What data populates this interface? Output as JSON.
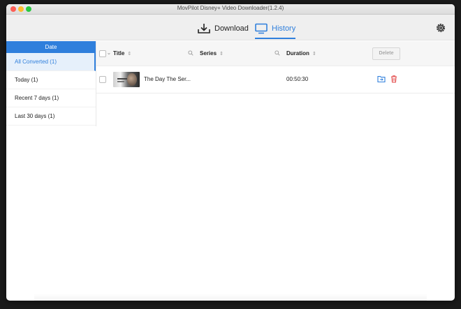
{
  "window": {
    "title": "MovPilot Disney+ Video Downloader(1.2.4)"
  },
  "toolbar": {
    "download_label": "Download",
    "history_label": "History",
    "settings_icon": "gear-icon"
  },
  "sidebar": {
    "header": "Date",
    "items": [
      {
        "label": "All Converted (1)",
        "active": true
      },
      {
        "label": "Today (1)",
        "active": false
      },
      {
        "label": "Recent 7 days (1)",
        "active": false
      },
      {
        "label": "Last 30 days (1)",
        "active": false
      }
    ]
  },
  "table": {
    "columns": {
      "title": "Title",
      "series": "Series",
      "duration": "Duration"
    },
    "delete_label": "Delete",
    "rows": [
      {
        "title": "The Day The Ser...",
        "series": "",
        "duration": "00:50:30"
      }
    ]
  },
  "colors": {
    "accent": "#2f7fdc",
    "delete_icon": "#e34a4a"
  }
}
